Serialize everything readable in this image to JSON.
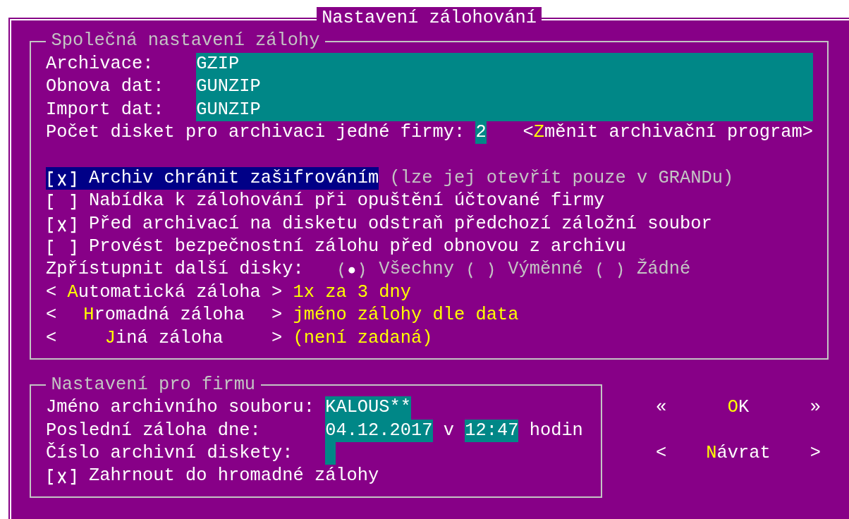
{
  "window": {
    "title": "Nastavení zálohování"
  },
  "common": {
    "title": "Společná nastavení zálohy",
    "fields": [
      {
        "label": "Archivace:",
        "value": "GZIP"
      },
      {
        "label": "Obnova dat:",
        "value": "GUNZIP"
      },
      {
        "label": "Import dat:",
        "value": "GUNZIP"
      }
    ],
    "disk_count": {
      "label": "Počet disket pro archivaci jedné firmy:",
      "value": "2"
    },
    "change_program_button": {
      "open": "<",
      "hotkey": "Z",
      "rest": "měnit archivační program",
      "close": ">"
    },
    "checkboxes": [
      {
        "label": "Archiv chránit zašifrováním",
        "note": "(lze jej otevřít pouze v GRANDu)",
        "checked": true,
        "focused": true
      },
      {
        "label": "Nabídka k zálohování při opuštění účtované firmy",
        "checked": false,
        "focused": false
      },
      {
        "label": "Před archivací na disketu odstraň předchozí záložní soubor",
        "checked": true,
        "focused": false
      },
      {
        "label": "Provést bezpečnostní zálohu před obnovou z archivu",
        "checked": false,
        "focused": false
      }
    ],
    "other_disks": {
      "label": "Zpřístupnit další disky:",
      "options": [
        {
          "label": "Všechny",
          "selected": true
        },
        {
          "label": "Výměnné",
          "selected": false
        },
        {
          "label": "Žádné",
          "selected": false
        }
      ]
    },
    "backups": [
      {
        "open": "<",
        "hotkey": "A",
        "rest": "utomatická záloha",
        "close": ">",
        "value": "1x za 3 dny"
      },
      {
        "open": "<",
        "hotkey": "H",
        "rest": "romadná záloha",
        "close": ">",
        "value": "jméno zálohy dle data"
      },
      {
        "open": "<",
        "hotkey": "J",
        "rest": "iná záloha",
        "close": ">",
        "value": "(není zadaná)"
      }
    ]
  },
  "company": {
    "title": "Nastavení pro firmu",
    "archive_name": {
      "label": "Jméno archivního souboru:",
      "value": "KALOUS**"
    },
    "last_backup": {
      "label": "Poslední záloha dne:",
      "date": "04.12.2017",
      "separator": "v",
      "time": "12:47",
      "unit": "hodin"
    },
    "disk_number": {
      "label": "Číslo archivní diskety:"
    },
    "include": {
      "label": "Zahrnout do hromadné zálohy",
      "checked": true,
      "focused": false
    }
  },
  "buttons": [
    {
      "open": "«",
      "hotkey": "O",
      "rest": "K",
      "close": "»"
    },
    {
      "open": "<",
      "hotkey": "N",
      "rest": "ávrat",
      "close": ">"
    }
  ]
}
